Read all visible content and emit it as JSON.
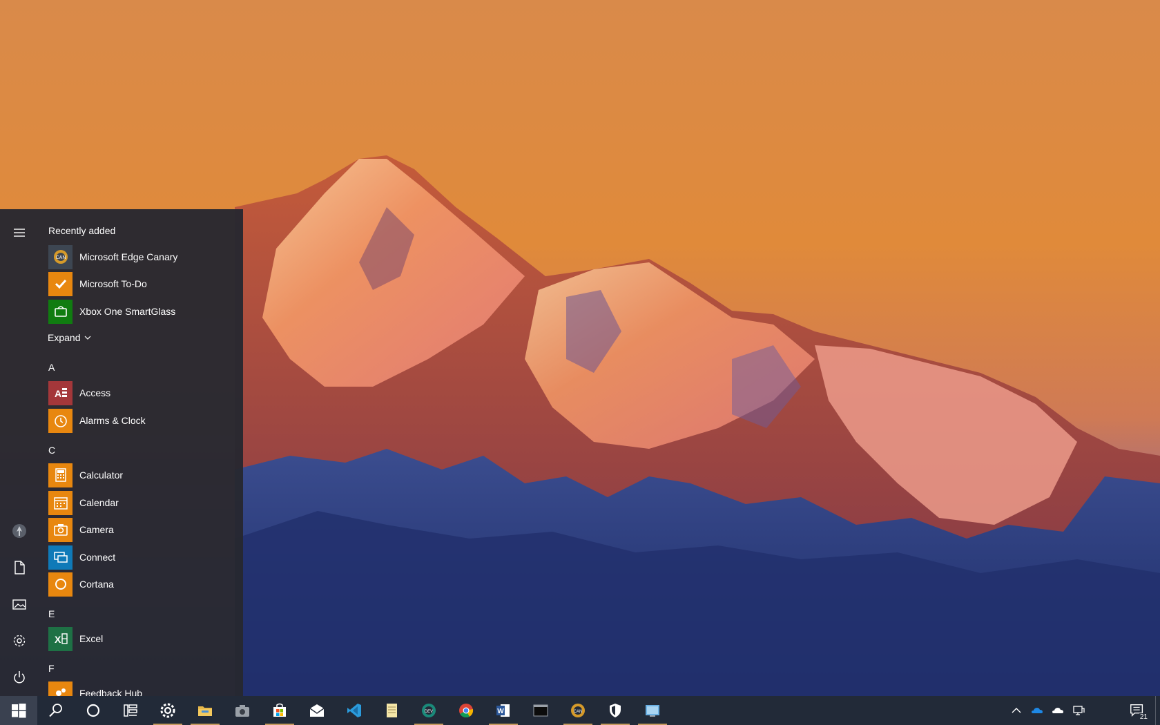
{
  "start_menu": {
    "recently_added_header": "Recently added",
    "recent_apps": [
      {
        "label": "Microsoft Edge Canary",
        "icon": "edge-canary-icon",
        "color": "#3d4652"
      },
      {
        "label": "Microsoft To-Do",
        "icon": "todo-check-icon",
        "color": "#e8870f"
      },
      {
        "label": "Xbox One SmartGlass",
        "icon": "smartglass-icon",
        "color": "#107c10"
      }
    ],
    "expand_label": "Expand",
    "letters": [
      "A",
      "C",
      "E",
      "F"
    ],
    "apps_a": [
      {
        "label": "Access",
        "icon": "access-icon",
        "color": "#a4373a"
      },
      {
        "label": "Alarms & Clock",
        "icon": "alarm-clock-icon",
        "color": "#e8870f"
      }
    ],
    "apps_c": [
      {
        "label": "Calculator",
        "icon": "calculator-icon",
        "color": "#e8870f"
      },
      {
        "label": "Calendar",
        "icon": "calendar-icon",
        "color": "#e8870f"
      },
      {
        "label": "Camera",
        "icon": "camera-icon",
        "color": "#e8870f"
      },
      {
        "label": "Connect",
        "icon": "connect-icon",
        "color": "#0f7ab8"
      },
      {
        "label": "Cortana",
        "icon": "cortana-icon",
        "color": "#e8870f"
      }
    ],
    "apps_e": [
      {
        "label": "Excel",
        "icon": "excel-icon",
        "color": "#1e7145"
      }
    ],
    "apps_f": [
      {
        "label": "Feedback Hub",
        "icon": "feedback-hub-icon",
        "color": "#e8870f"
      }
    ],
    "rail_icons": [
      "hamburger-icon",
      "user-avatar-icon",
      "documents-icon",
      "pictures-icon",
      "settings-icon",
      "power-icon"
    ]
  },
  "taskbar": {
    "pinned": [
      "windows-logo-icon",
      "search-icon",
      "cortana-circle-icon",
      "task-view-icon",
      "settings-gear-icon",
      "file-explorer-icon",
      "camera-icon",
      "store-icon",
      "mail-icon",
      "vs-code-icon",
      "notepad-icon",
      "edge-dev-icon",
      "chrome-icon",
      "word-icon",
      "terminal-icon",
      "edge-canary-icon",
      "security-shield-icon",
      "remote-desktop-icon"
    ],
    "tray_icons": [
      "chevron-up-icon",
      "onedrive-icon",
      "onedrive-personal-icon",
      "network-icon"
    ],
    "notification_count": "21"
  },
  "colors": {
    "taskbar_bg": "#222a38",
    "start_bg": "#262830",
    "accent_orange": "#e8870f",
    "running_indicator": "#c59a5e"
  }
}
